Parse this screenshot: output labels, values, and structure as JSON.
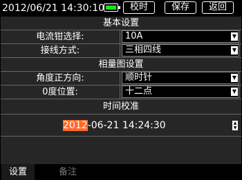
{
  "topbar": {
    "datetime": "2012/06/21 14:30:10",
    "buttons": {
      "calibrate": "校时",
      "save": "保存",
      "back": "返回"
    }
  },
  "sections": {
    "basic": "基本设置",
    "phasor": "相量图设置",
    "time": "时间校准"
  },
  "fields": {
    "clamp": {
      "label": "电流钳选择:",
      "value": "10A"
    },
    "wiring": {
      "label": "接线方式:",
      "value": "三相四线"
    },
    "angle_direction": {
      "label": "角度正方向:",
      "value": "顺时针"
    },
    "zero_position": {
      "label": "0度位置:",
      "value": "十二点"
    }
  },
  "time_calibration": {
    "year": "2012",
    "rest": "-06-21 14:24:30"
  },
  "tabs": {
    "settings": "设置",
    "notes": "备注"
  },
  "colors": {
    "battery": "#19e619",
    "selection": "#ff6a2a",
    "panel": "#262626"
  }
}
